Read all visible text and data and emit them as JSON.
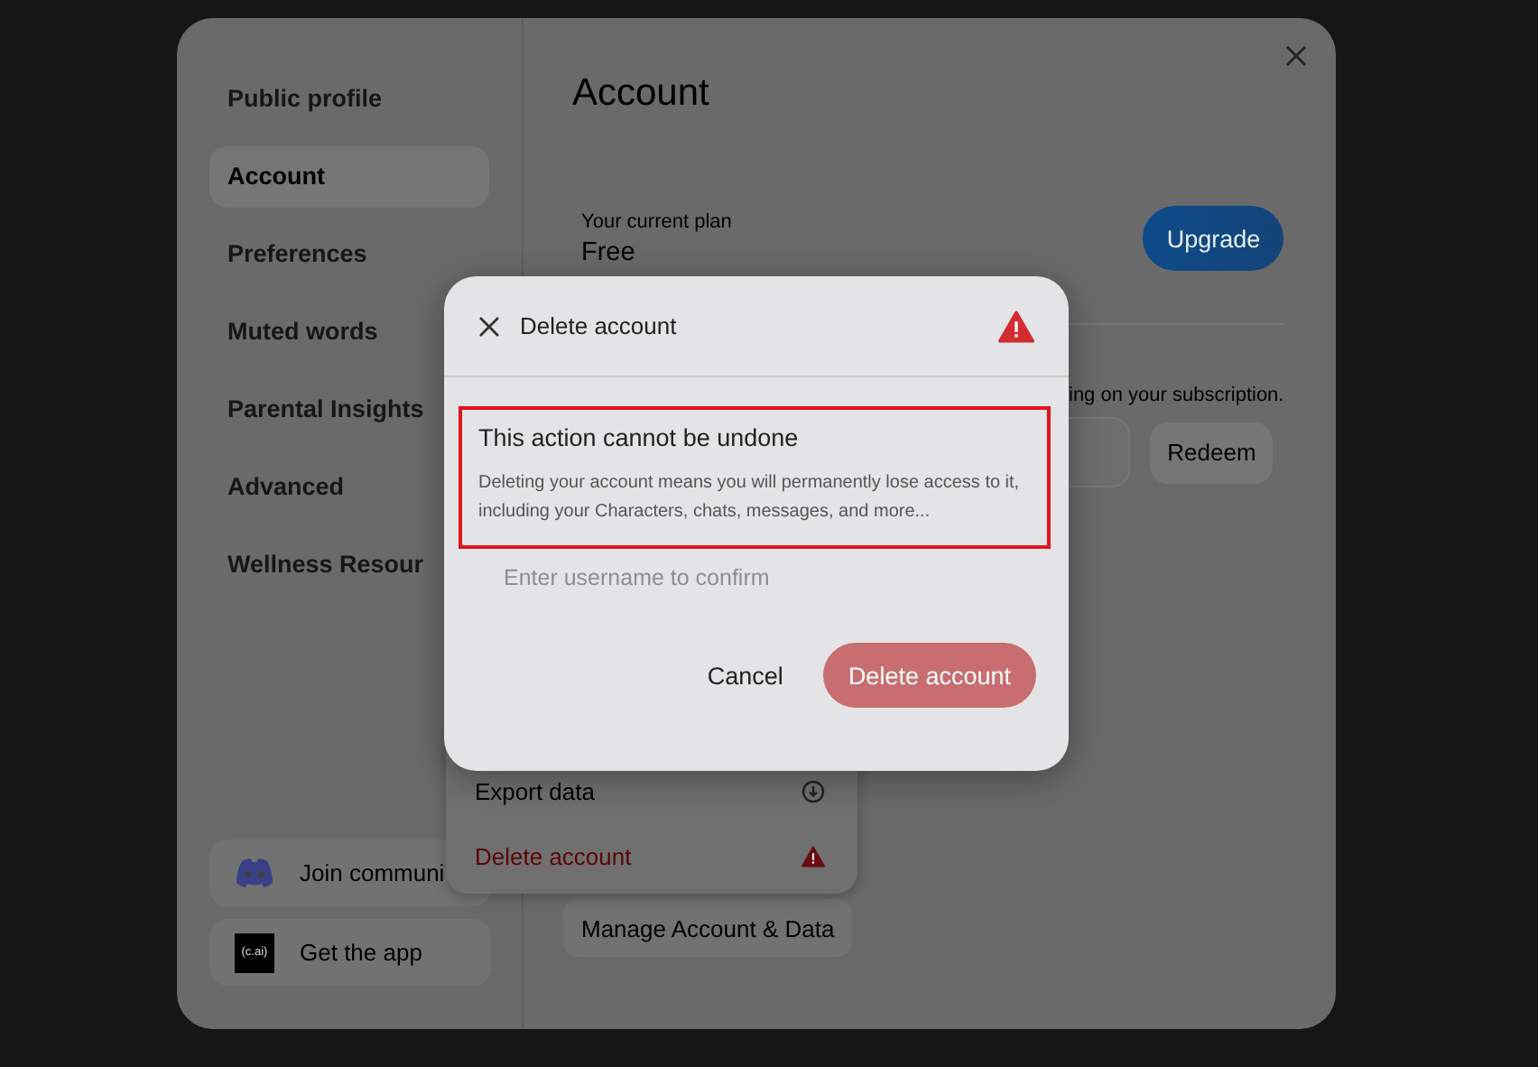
{
  "sidebar": {
    "items": [
      {
        "label": "Public profile",
        "selected": false
      },
      {
        "label": "Account",
        "selected": true
      },
      {
        "label": "Preferences",
        "selected": false
      },
      {
        "label": "Muted words",
        "selected": false
      },
      {
        "label": "Parental Insights",
        "selected": false
      },
      {
        "label": "Advanced",
        "selected": false
      },
      {
        "label": "Wellness Resour",
        "selected": false
      }
    ],
    "footer": [
      {
        "kind": "discord",
        "label": "Join communi"
      },
      {
        "kind": "app",
        "logo": "(c.ai)",
        "label": "Get the app"
      }
    ]
  },
  "account": {
    "title": "Account",
    "plan_label": "Your current plan",
    "plan": "Free",
    "upgrade": "Upgrade",
    "subscription_note": "ing on your subscription.",
    "redeem": "Redeem",
    "manage": "Manage Account & Data"
  },
  "menu": [
    {
      "kind": "export",
      "label": "Export data"
    },
    {
      "kind": "danger",
      "label": "Delete account"
    }
  ],
  "dialog": {
    "title": "Delete account",
    "warning_title": "This action cannot be undone",
    "warning_text": "Deleting your account means you will permanently lose access to it, including your Characters, chats, messages, and more...",
    "placeholder": "Enter username to confirm",
    "cancel": "Cancel",
    "confirm": "Delete account",
    "confirm_disabled": true
  }
}
